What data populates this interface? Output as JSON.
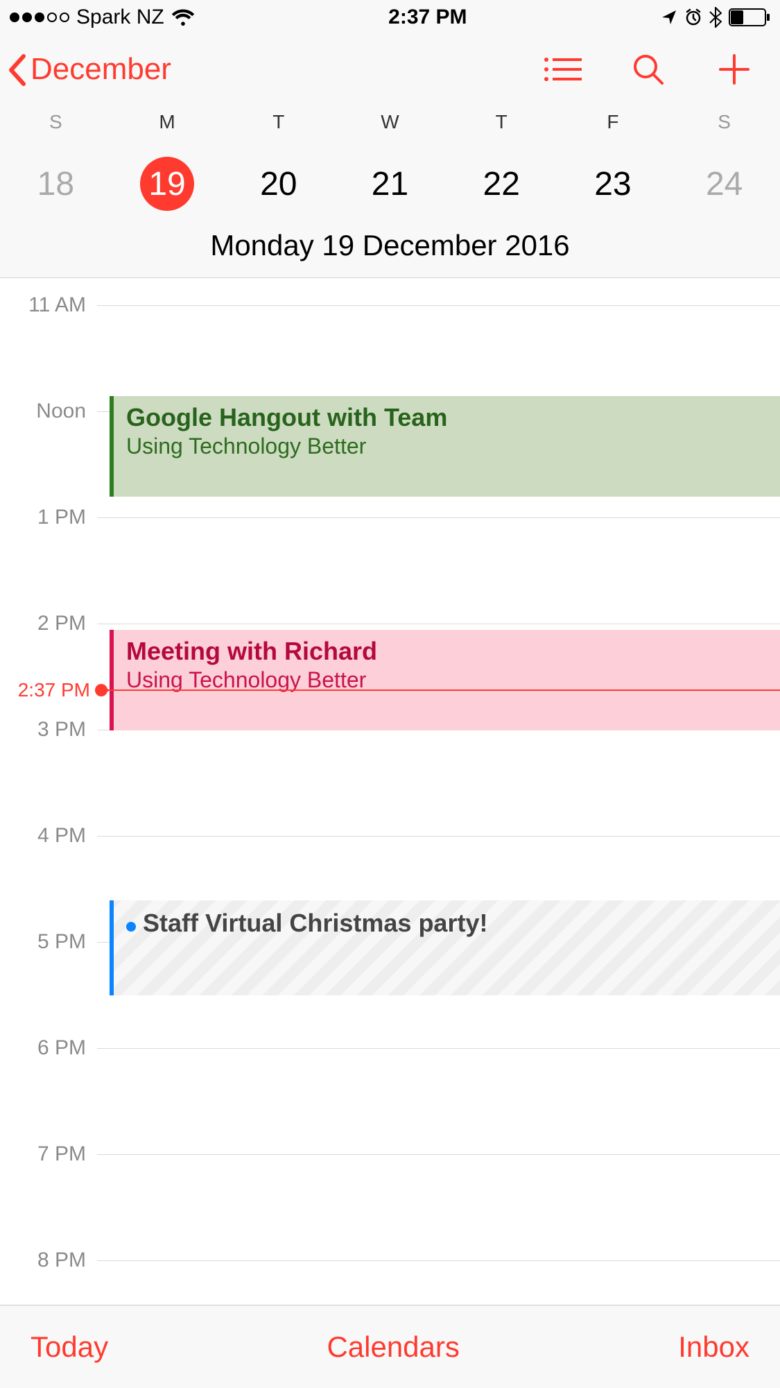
{
  "status_bar": {
    "carrier": "Spark NZ",
    "time": "2:37 PM",
    "signal_filled": 3,
    "signal_total": 5
  },
  "header": {
    "back_label": "December"
  },
  "week": {
    "labels": [
      "S",
      "M",
      "T",
      "W",
      "T",
      "F",
      "S"
    ],
    "dates": [
      {
        "n": "18",
        "weekend": true,
        "selected": false
      },
      {
        "n": "19",
        "weekend": false,
        "selected": true
      },
      {
        "n": "20",
        "weekend": false,
        "selected": false
      },
      {
        "n": "21",
        "weekend": false,
        "selected": false
      },
      {
        "n": "22",
        "weekend": false,
        "selected": false
      },
      {
        "n": "23",
        "weekend": false,
        "selected": false
      },
      {
        "n": "24",
        "weekend": true,
        "selected": false
      }
    ],
    "full_date": "Monday  19 December 2016"
  },
  "hours": [
    "11 AM",
    "Noon",
    "1 PM",
    "2 PM",
    "3 PM",
    "4 PM",
    "5 PM",
    "6 PM",
    "7 PM",
    "8 PM"
  ],
  "events": [
    {
      "title": "Google Hangout with Team",
      "location": "Using Technology Better",
      "color": "green",
      "start_hour": 11.85,
      "end_hour": 12.8
    },
    {
      "title": "Meeting with Richard",
      "location": "Using Technology Better",
      "color": "pink",
      "start_hour": 14.05,
      "end_hour": 15.0
    },
    {
      "title": "Staff Virtual Christmas party!",
      "location": "",
      "color": "stripe",
      "start_hour": 16.6,
      "end_hour": 17.5
    }
  ],
  "now": {
    "label": "2:37 PM",
    "hour": 14.62
  },
  "toolbar": {
    "left": "Today",
    "center": "Calendars",
    "right": "Inbox"
  },
  "colors": {
    "accent": "#ff3b30"
  }
}
